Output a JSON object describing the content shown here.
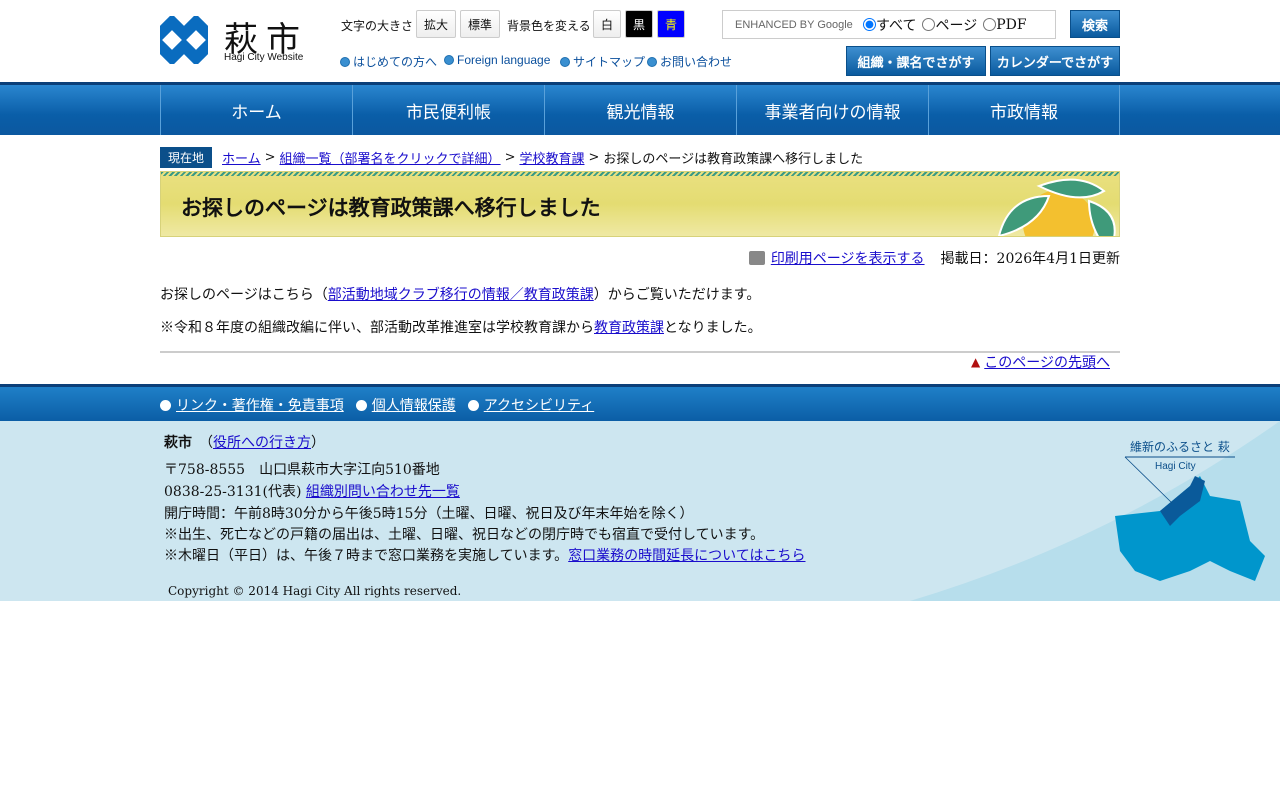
{
  "header": {
    "logo_text": "萩市",
    "logo_sub": "Hagi City Website",
    "font_size_label": "文字の大きさ",
    "font_enlarge": "拡大",
    "font_standard": "標準",
    "bg_label": "背景色を変える",
    "bg_white": "白",
    "bg_black": "黒",
    "bg_blue": "青",
    "links": [
      "はじめての方へ",
      "Foreign language",
      "サイトマップ",
      "お問い合わせ"
    ],
    "search": {
      "brand": "ENHANCED BY Google",
      "options": [
        "すべて",
        "ページ",
        "PDF"
      ],
      "selected": "すべて",
      "button": "検索"
    },
    "org_search": "組織・課名でさがす",
    "calendar_search": "カレンダーでさがす"
  },
  "nav": [
    "ホーム",
    "市民便利帳",
    "観光情報",
    "事業者向けの情報",
    "市政情報"
  ],
  "breadcrumb": {
    "label": "現在地",
    "items": [
      "ホーム",
      "組織一覧（部署名をクリックで詳細）",
      "学校教育課"
    ],
    "current": "お探しのページは教育政策課へ移行しました"
  },
  "page": {
    "title": "お探しのページは教育政策課へ移行しました",
    "print": "印刷用ページを表示する",
    "date": "掲載日：2026年4月1日更新",
    "p1_pre": "お探しのページはこちら（",
    "p1_link": "部活動地域クラブ移行の情報／教育政策課",
    "p1_post": "）からご覧いただけます。",
    "p2_pre": "※令和８年度の組織改編に伴い、部活動改革推進室は学校教育課から",
    "p2_link": "教育政策課",
    "p2_post": "となりました。",
    "to_top": "このページの先頭へ"
  },
  "footer": {
    "links": [
      "リンク・著作権・免責事項",
      "個人情報保護",
      "アクセシビリティ"
    ],
    "name": "萩市",
    "access": "役所への行き方",
    "address": "〒758-8555　山口県萩市大字江向510番地",
    "phone": "0838-25-3131(代表)",
    "contacts": "組織別問い合わせ先一覧",
    "hours": "開庁時間：午前8時30分から午後5時15分（土曜、日曜、祝日及び年末年始を除く）",
    "note1": "※出生、死亡などの戸籍の届出は、土曜、日曜、祝日などの閉庁時でも宿直で受付しています。",
    "note2": "※木曜日（平日）は、午後７時まで窓口業務を実施しています。",
    "note2_link": "窓口業務の時間延長についてはこちら",
    "copyright": "Copyright © 2014 Hagi City All rights reserved.",
    "map_title": "維新のふるさと 萩",
    "map_sub": "Hagi City"
  }
}
